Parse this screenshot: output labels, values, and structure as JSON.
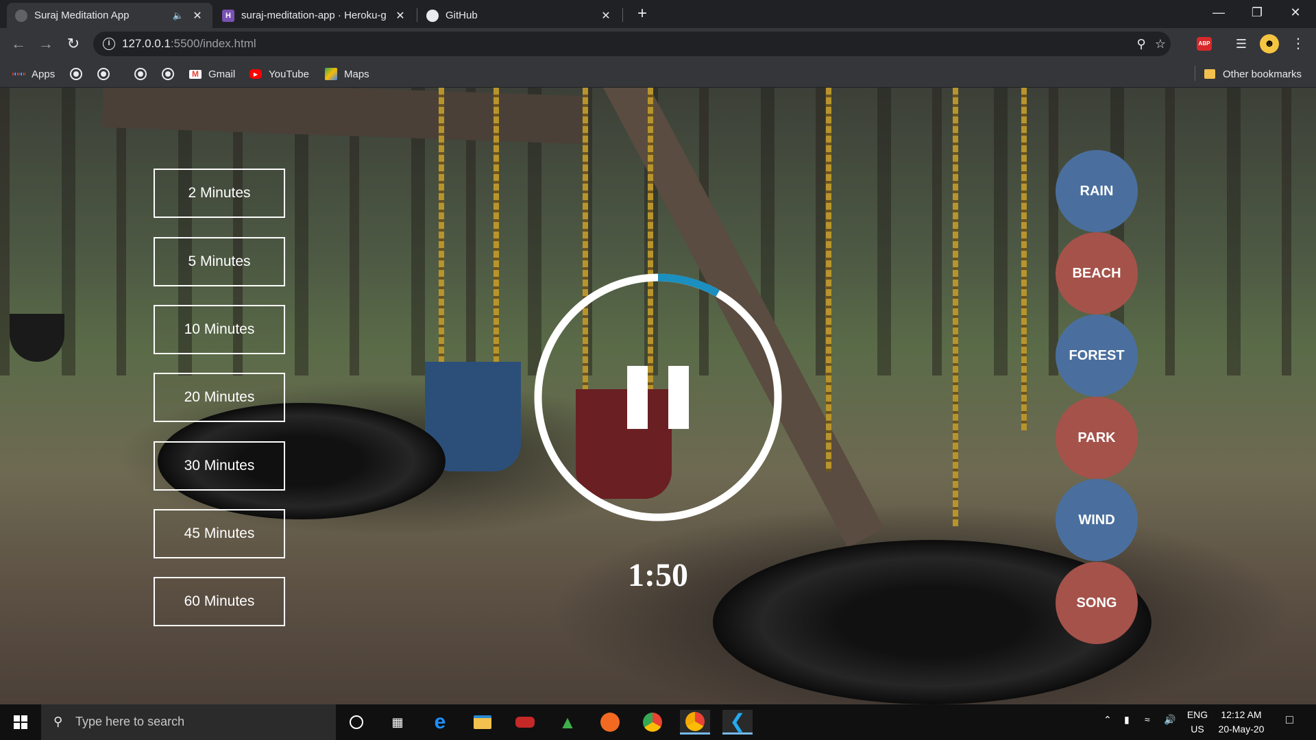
{
  "browser": {
    "tabs": [
      {
        "title": "Suraj Meditation App",
        "active": true
      },
      {
        "title": "suraj-meditation-app · Heroku-g",
        "active": false
      },
      {
        "title": "GitHub",
        "active": false
      }
    ],
    "url_host": "127.0.0.1",
    "url_rest": ":5500/index.html",
    "bookmarks": {
      "apps": "Apps",
      "gmail": "Gmail",
      "youtube": "YouTube",
      "maps": "Maps",
      "other": "Other bookmarks"
    },
    "extension_abp": "ABP"
  },
  "app": {
    "durations": [
      "2 Minutes",
      "5 Minutes",
      "10 Minutes",
      "20 Minutes",
      "30 Minutes",
      "45 Minutes",
      "60 Minutes"
    ],
    "time_display": "1:50",
    "progress_fraction": 0.083,
    "sounds": [
      {
        "label": "RAIN",
        "color": "#4a6f9f"
      },
      {
        "label": "BEACH",
        "color": "#a5524a"
      },
      {
        "label": "FOREST",
        "color": "#4a6f9f"
      },
      {
        "label": "PARK",
        "color": "#a5524a"
      },
      {
        "label": "WIND",
        "color": "#4a6f9f"
      },
      {
        "label": "SONG",
        "color": "#a5524a"
      }
    ],
    "colors": {
      "ring": "#ffffff",
      "progress": "#1a8fc0"
    }
  },
  "taskbar": {
    "search_placeholder": "Type here to search",
    "lang": "ENG",
    "region": "US",
    "time": "12:12 AM",
    "date": "20-May-20"
  }
}
